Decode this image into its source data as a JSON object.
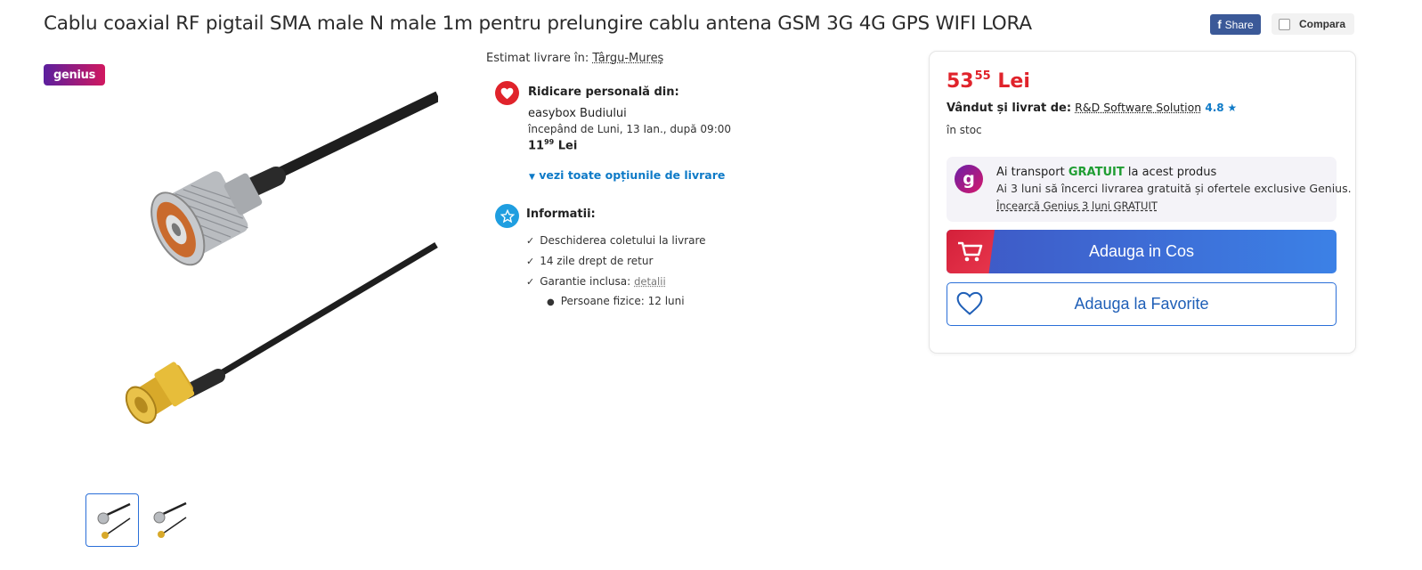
{
  "product": {
    "title": "Cablu coaxial RF pigtail SMA male N male 1m pentru prelungire cablu antena GSM 3G 4G GPS WIFI LORA"
  },
  "actions": {
    "share_label": "Share",
    "compare_label": "Compara"
  },
  "gallery": {
    "genius_badge": "genius"
  },
  "delivery": {
    "estimate_label": "Estimat livrare în:",
    "location": "Târgu-Mureș",
    "pickup_title": "Ridicare personală din:",
    "pickup_place": "easybox Budiului",
    "pickup_date": "începând de Luni, 13 Ian., după 09:00",
    "pickup_price_int": "11",
    "pickup_price_dec": "99",
    "pickup_currency": "Lei",
    "all_options_link": "vezi toate opțiunile de livrare"
  },
  "info": {
    "title": "Informatii:",
    "item1": "Deschiderea coletului la livrare",
    "item2": "14 zile drept de retur",
    "item3": "Garantie inclusa:",
    "item3_link": "detalii",
    "sub_item": "Persoane fizice: 12 luni"
  },
  "buybox": {
    "price_int": "53",
    "price_dec": "55",
    "currency": "Lei",
    "seller_label": "Vândut și livrat de:",
    "seller_name": "R&D Software Solution",
    "seller_rating": "4.8",
    "stock": "în stoc",
    "genius_line1_pre": "Ai transport",
    "genius_line1_free": "GRATUIT",
    "genius_line1_post": "la acest produs",
    "genius_line2": "Ai 3 luni să încerci livrarea gratuită și ofertele exclusive Genius.",
    "genius_link": "Încearcă Genius 3 luni GRATUIT",
    "add_to_cart": "Adauga in Cos",
    "add_to_fav": "Adauga la Favorite"
  },
  "colors": {
    "price_red": "#e0232b",
    "link_blue": "#0e7ac7",
    "free_green": "#1f9d32",
    "cart_blue": "#3c6fd8"
  }
}
